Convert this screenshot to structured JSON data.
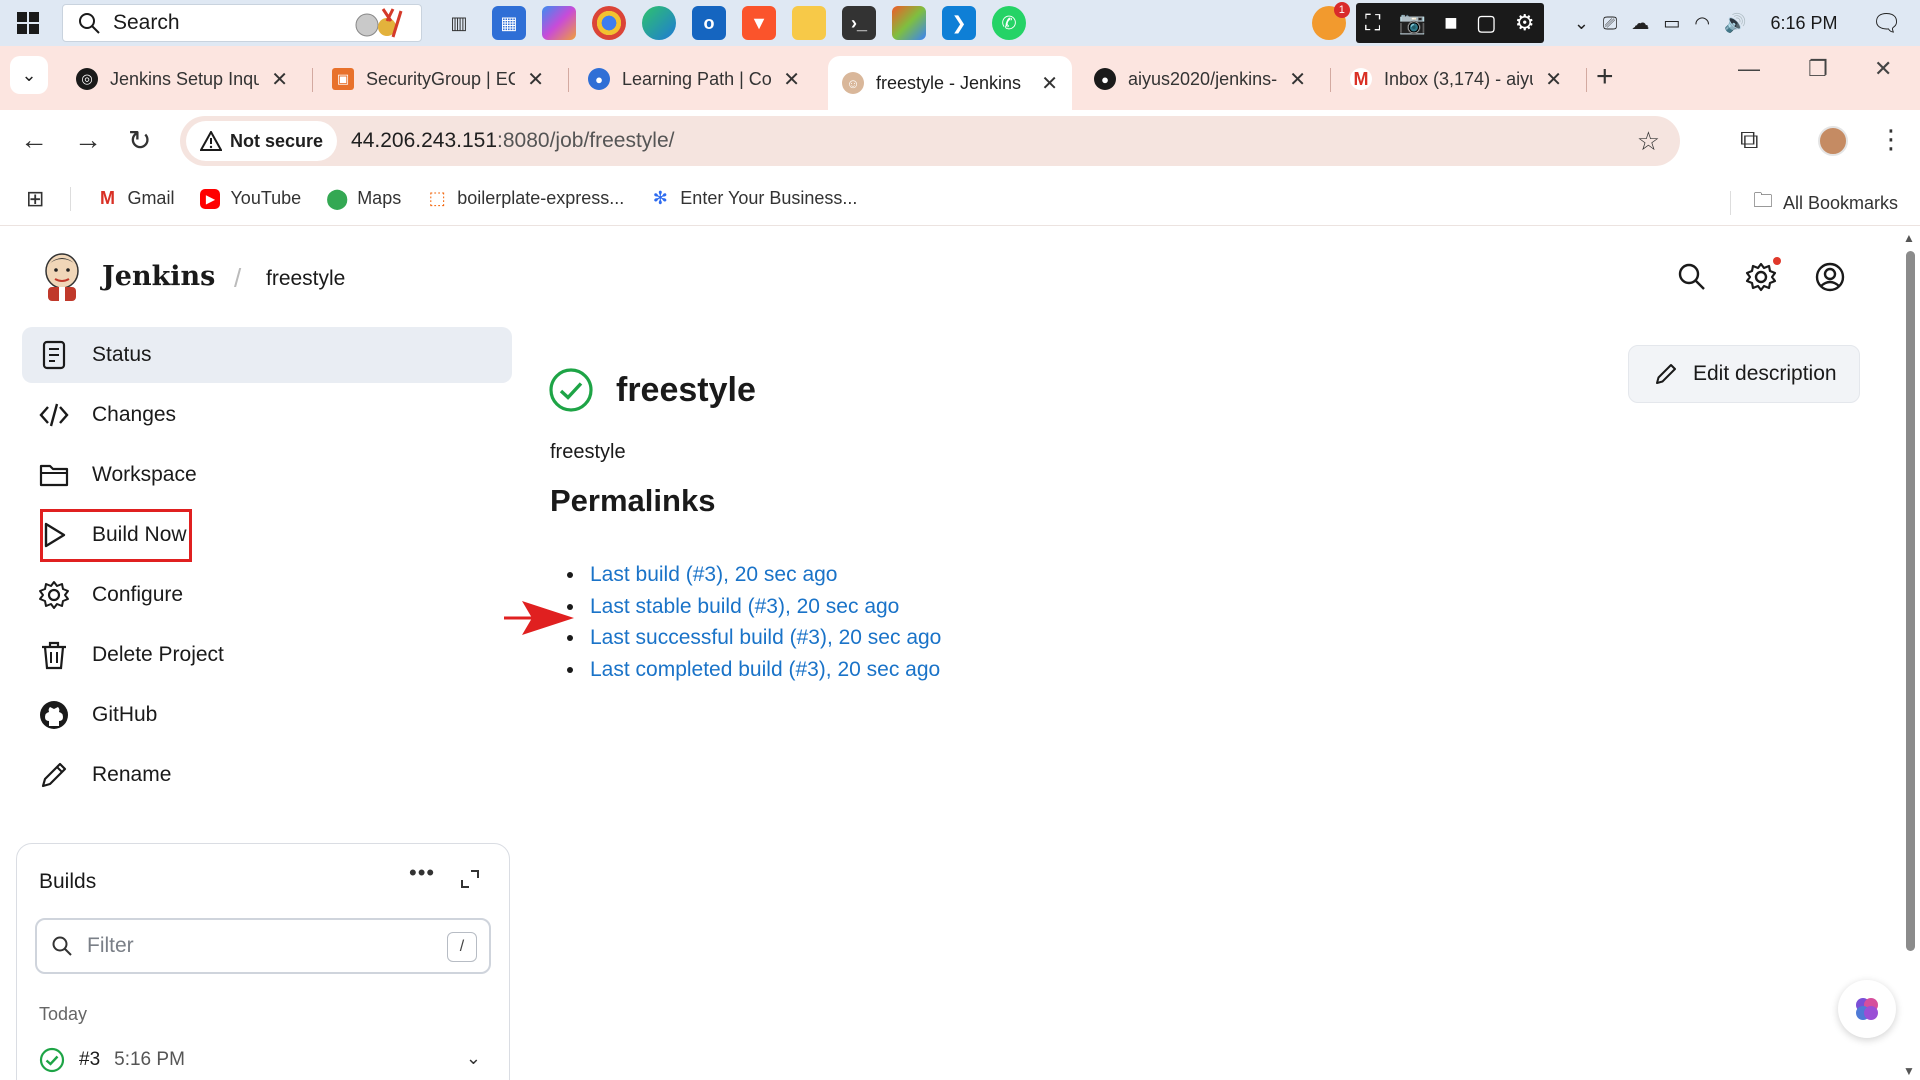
{
  "taskbar": {
    "search_label": "Search",
    "clock": "6:16 PM",
    "notification_count": "1",
    "apps": [
      "task-view",
      "store",
      "copilot",
      "chrome",
      "edge",
      "outlook",
      "brave",
      "file-explorer",
      "terminal",
      "app-generic",
      "vscode",
      "whatsapp"
    ]
  },
  "tabs": [
    {
      "title": "Jenkins Setup Inqu",
      "icon": "chatgpt-icon"
    },
    {
      "title": "SecurityGroup | EC",
      "icon": "aws-icon"
    },
    {
      "title": "Learning Path | Col",
      "icon": "learning-icon"
    },
    {
      "title": "freestyle - Jenkins",
      "icon": "jenkins-icon"
    },
    {
      "title": "aiyus2020/jenkins-",
      "icon": "github-icon"
    },
    {
      "title": "Inbox (3,174) - aiyu",
      "icon": "gmail-icon"
    }
  ],
  "address": {
    "security_label": "Not secure",
    "url_host": "44.206.243.151",
    "url_rest": ":8080/job/freestyle/"
  },
  "bookmarks": [
    {
      "label": "Gmail",
      "icon": "gmail-icon"
    },
    {
      "label": "YouTube",
      "icon": "youtube-icon"
    },
    {
      "label": "Maps",
      "icon": "maps-icon"
    },
    {
      "label": "boilerplate-express...",
      "icon": "replit-icon"
    },
    {
      "label": "Enter Your Business...",
      "icon": "business-icon"
    }
  ],
  "bookmarks_all": "All Bookmarks",
  "jenkins": {
    "brand": "Jenkins",
    "breadcrumb": "freestyle",
    "sidebar": [
      {
        "label": "Status",
        "icon": "status-icon"
      },
      {
        "label": "Changes",
        "icon": "code-icon"
      },
      {
        "label": "Workspace",
        "icon": "folder-icon"
      },
      {
        "label": "Build Now",
        "icon": "play-icon"
      },
      {
        "label": "Configure",
        "icon": "gear-icon"
      },
      {
        "label": "Delete Project",
        "icon": "trash-icon"
      },
      {
        "label": "GitHub",
        "icon": "github-icon"
      },
      {
        "label": "Rename",
        "icon": "pencil-icon"
      }
    ],
    "builds": {
      "title": "Builds",
      "filter_placeholder": "Filter",
      "filter_shortcut": "/",
      "group_label": "Today",
      "rows": [
        {
          "number": "#3",
          "time": "5:16 PM",
          "status": "success"
        }
      ]
    },
    "job": {
      "title": "freestyle",
      "description": "freestyle",
      "edit_description": "Edit description",
      "permalinks_heading": "Permalinks",
      "permalinks": [
        "Last build (#3), 20 sec ago",
        "Last stable build (#3), 20 sec ago",
        "Last successful build (#3), 20 sec ago",
        "Last completed build (#3), 20 sec ago"
      ]
    }
  },
  "colors": {
    "link": "#1a73c8",
    "success": "#1ea446",
    "highlight": "#e02020",
    "tabstrip": "#fce5e0"
  }
}
